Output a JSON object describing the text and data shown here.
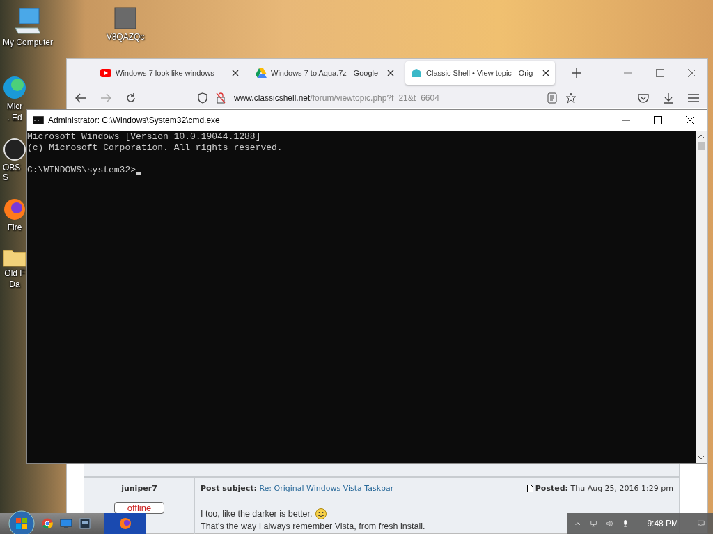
{
  "desktop": {
    "icons": [
      {
        "kind": "computer",
        "lines": [
          "My Computer"
        ]
      },
      {
        "kind": "file",
        "lines": [
          "V8QAZQc"
        ]
      },
      {
        "kind": "edge",
        "lines": [
          "Micr",
          ". Ed"
        ]
      },
      {
        "kind": "obs",
        "lines": [
          "OBS S"
        ]
      },
      {
        "kind": "firefox",
        "lines": [
          "Fire"
        ]
      },
      {
        "kind": "folder",
        "lines": [
          "Old F",
          "Da"
        ]
      }
    ]
  },
  "browser": {
    "tabs": [
      {
        "kind": "video",
        "title": "Windows 7 look like windows",
        "selected": false
      },
      {
        "kind": "drive",
        "title": "Windows 7 to Aqua.7z - Google",
        "selected": false
      },
      {
        "kind": "shell",
        "title": "Classic Shell • View topic - Orig",
        "selected": true
      }
    ],
    "url": {
      "domain": "www.classicshell.net",
      "path": "/forum/viewtopic.php?f=21&t=6604"
    },
    "post": {
      "author": "juniper7",
      "status": "offline",
      "subject_label": "Post subject:",
      "subject": "Re: Original Windows Vista Taskbar",
      "posted_label": "Posted:",
      "posted": "Thu Aug 25, 2016 1:29 pm",
      "body": [
        "I too, like the darker is better.",
        "That's the way I always remember Vista, from fresh install."
      ]
    }
  },
  "console": {
    "title": "Administrator: C:\\Windows\\System32\\cmd.exe",
    "banner": [
      "Microsoft Windows [Version 10.0.19044.1288]",
      "(c) Microsoft Corporation. All rights reserved."
    ],
    "prompt": "C:\\WINDOWS\\system32>"
  },
  "taskbar": {
    "pinned": [
      {
        "kind": "chrome"
      },
      {
        "kind": "screen"
      },
      {
        "kind": "windows"
      },
      {
        "kind": "firefox"
      }
    ],
    "clock": "9:48 PM"
  }
}
